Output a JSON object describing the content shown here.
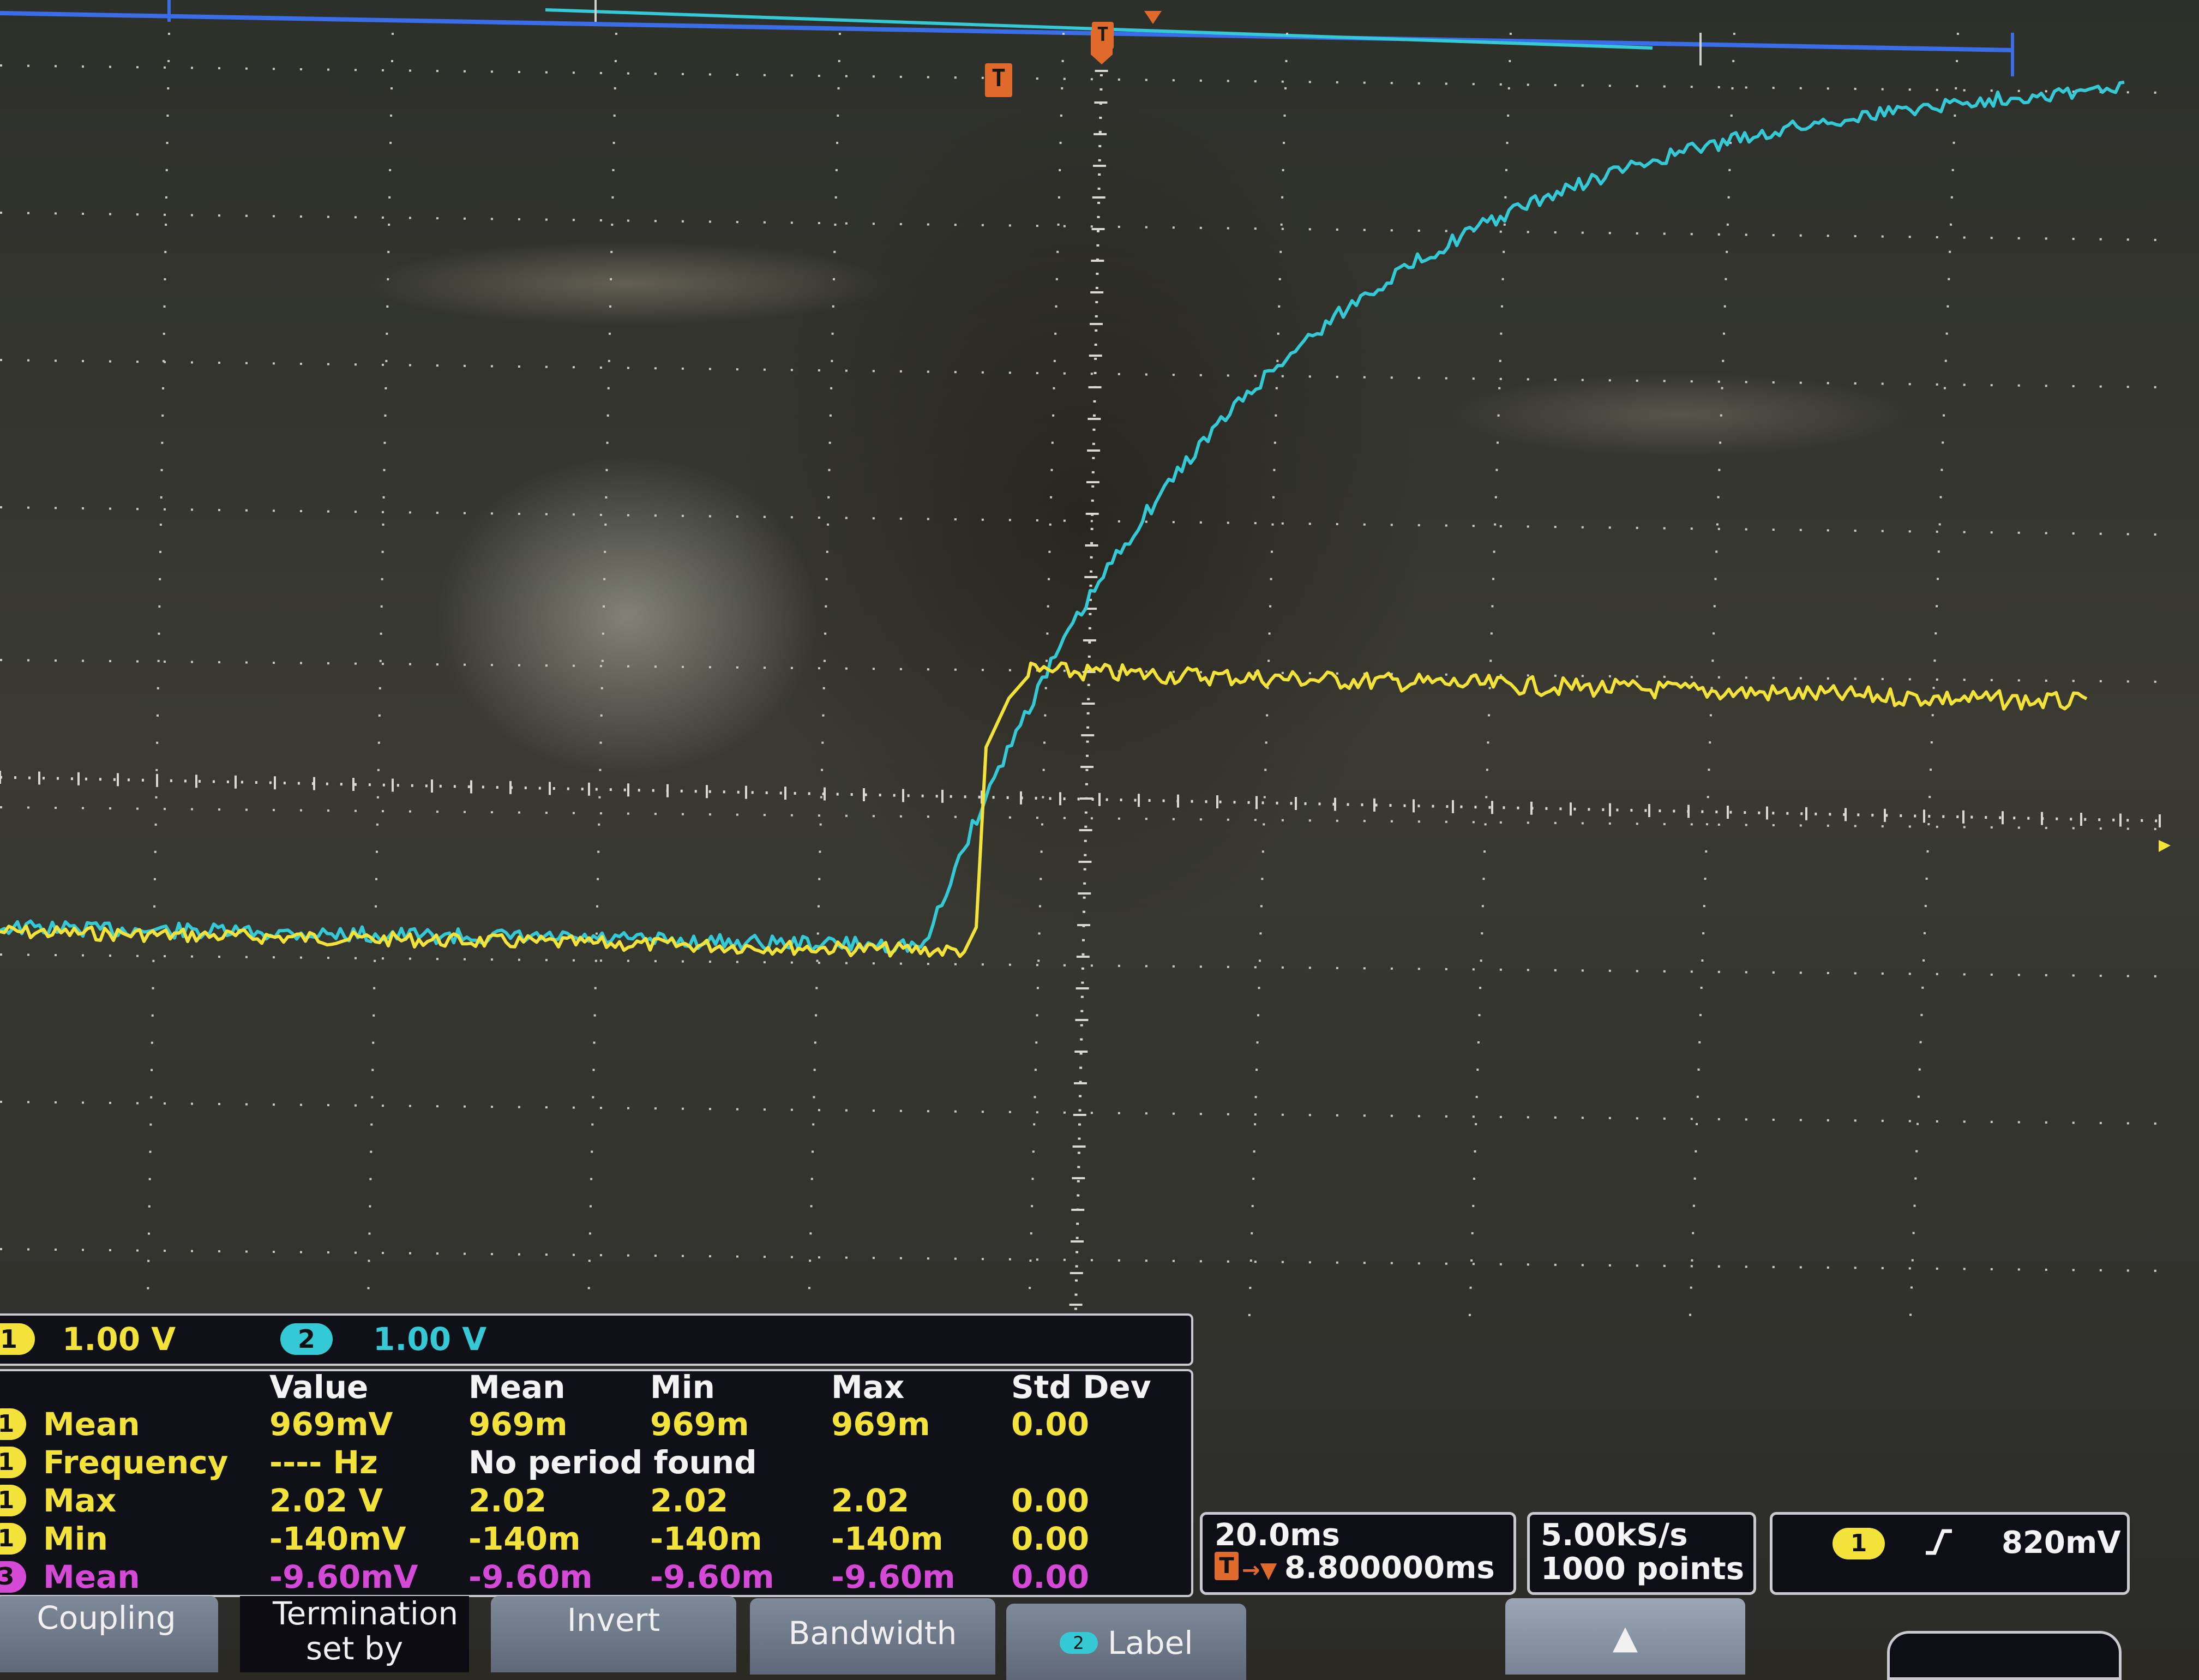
{
  "screen": {
    "channel_scales": [
      {
        "channel": "1",
        "value": "1.00 V",
        "color": "#f2e23a"
      },
      {
        "channel": "2",
        "value": "1.00 V",
        "color": "#35c9d6"
      }
    ],
    "trigger_marker": "T",
    "measurements": {
      "headers": [
        "Value",
        "Mean",
        "Min",
        "Max",
        "Std Dev"
      ],
      "rows": [
        {
          "channel": "1",
          "name": "Mean",
          "value": "969mV",
          "mean": "969m",
          "min": "969m",
          "max": "969m",
          "std": "0.00",
          "color": "yellow"
        },
        {
          "channel": "1",
          "name": "Frequency",
          "value": "---- Hz",
          "note": "No period found",
          "color": "yellow"
        },
        {
          "channel": "1",
          "name": "Max",
          "value": "2.02 V",
          "mean": "2.02",
          "min": "2.02",
          "max": "2.02",
          "std": "0.00",
          "color": "yellow"
        },
        {
          "channel": "1",
          "name": "Min",
          "value": "-140mV",
          "mean": "-140m",
          "min": "-140m",
          "max": "-140m",
          "std": "0.00",
          "color": "yellow"
        },
        {
          "channel": "3",
          "name": "Mean",
          "value": "-9.60mV",
          "mean": "-9.60m",
          "min": "-9.60m",
          "max": "-9.60m",
          "std": "0.00",
          "color": "magenta"
        }
      ]
    },
    "timebase": {
      "scale": "20.0ms",
      "trigger_position": "8.800000ms"
    },
    "acquisition": {
      "sample_rate": "5.00kS/s",
      "record_length": "1000 points"
    },
    "trigger": {
      "channel": "1",
      "slope_icon": "rising-edge-icon",
      "level": "820mV"
    },
    "buttons": [
      "Coupling",
      "Termination set by",
      "Invert",
      "Bandwidth",
      "Label"
    ],
    "colors": {
      "ch1": "#f2e23a",
      "ch2": "#35c9d6",
      "ch3": "#d44ad6",
      "trigger": "#e06a2c",
      "record_bar": "#3a6ee8"
    }
  }
}
